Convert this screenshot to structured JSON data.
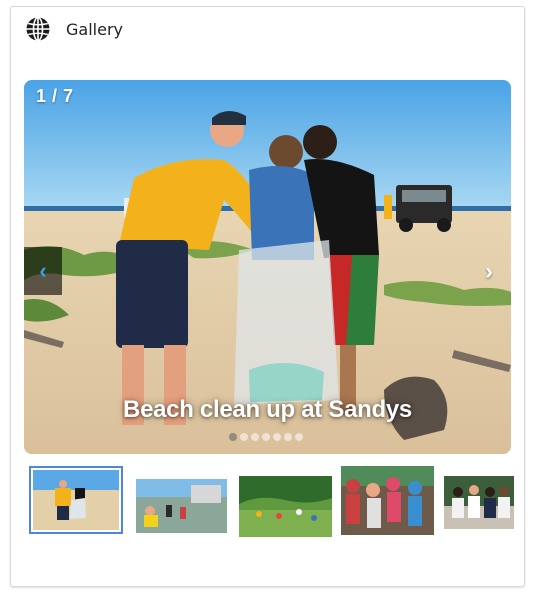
{
  "header": {
    "icon": "globe-icon",
    "title": "Gallery"
  },
  "slider": {
    "counter": "1 / 7",
    "caption": "Beach clean up at Sandys",
    "total_slides": 7,
    "current_slide": 1,
    "prev_icon": "chevron-left-icon",
    "next_icon": "chevron-right-icon",
    "prev_glyph": "‹",
    "next_glyph": "›"
  },
  "thumbnails": [
    {
      "subject": "beach clean up",
      "selected": true
    },
    {
      "subject": "water activity",
      "selected": false
    },
    {
      "subject": "green field",
      "selected": false
    },
    {
      "subject": "crowd",
      "selected": false
    },
    {
      "subject": "group photo",
      "selected": false
    }
  ],
  "colors": {
    "accent": "#4f86d8",
    "nav_arrow": "#3ba0e8"
  }
}
